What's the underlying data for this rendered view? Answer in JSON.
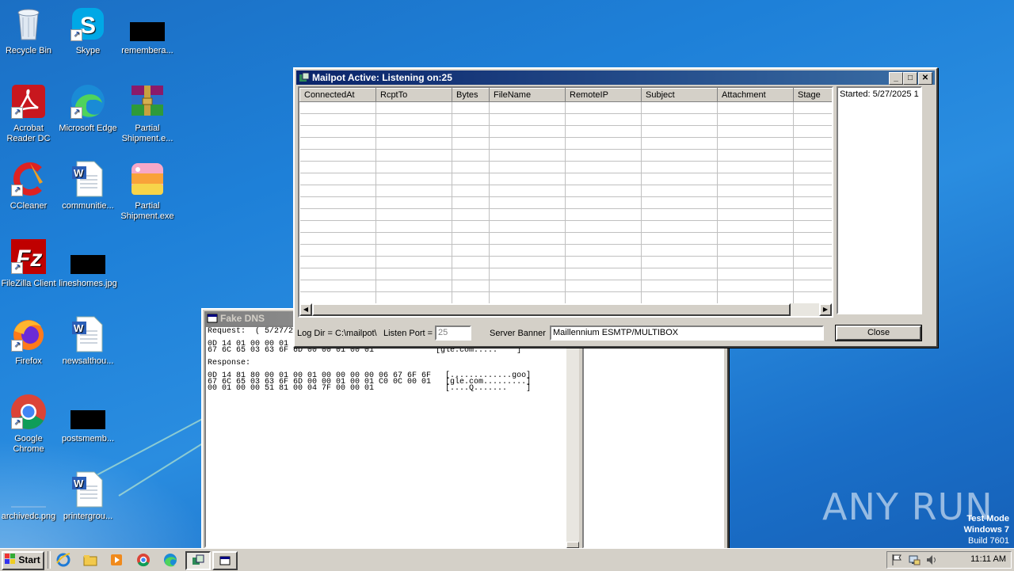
{
  "desktop": {
    "icons": [
      {
        "label": "Recycle Bin",
        "icon": "recycle-bin-icon"
      },
      {
        "label": "Skype",
        "icon": "skype-icon"
      },
      {
        "label": "remembera...",
        "icon": "black-image-icon"
      },
      {
        "label": "Acrobat\nReader DC",
        "icon": "acrobat-icon"
      },
      {
        "label": "Microsoft Edge",
        "icon": "edge-icon"
      },
      {
        "label": "Partial\nShipment.e...",
        "icon": "winrar-icon"
      },
      {
        "label": "CCleaner",
        "icon": "ccleaner-icon"
      },
      {
        "label": "communitie...",
        "icon": "word-doc-icon"
      },
      {
        "label": "Partial\nShipment.exe",
        "icon": "app-icon"
      },
      {
        "label": "FileZilla Client",
        "icon": "filezilla-icon"
      },
      {
        "label": "lineshomes.jpg",
        "icon": "black-image-icon"
      },
      {
        "label": "Firefox",
        "icon": "firefox-icon"
      },
      {
        "label": "newsalthou...",
        "icon": "word-doc-icon"
      },
      {
        "label": "Google\nChrome",
        "icon": "chrome-icon"
      },
      {
        "label": "postsmemb...",
        "icon": "black-image-icon"
      },
      {
        "label": "archivedc.png",
        "icon": "image-icon"
      },
      {
        "label": "printergrou...",
        "icon": "word-doc-icon"
      }
    ]
  },
  "mailpot": {
    "title": "Mailpot Active: Listening on:25",
    "columns": [
      "ConnectedAt",
      "RcptTo",
      "Bytes",
      "FileName",
      "RemoteIP",
      "Subject",
      "Attachment",
      "Stage"
    ],
    "log_text": "Started: 5/27/2025 1",
    "log_dir_label": "Log Dir = C:\\mailpot\\",
    "listen_port_label": "Listen Port =",
    "listen_port_value": "25",
    "server_banner_label": "Server Banner",
    "server_banner_value": "Maillennium ESMTP/MULTIBOX",
    "close_label": "Close"
  },
  "fakedns": {
    "title": "Fake DNS",
    "request_label": "Request:  ( 5/27/2",
    "request_hex": "0D 14 01 00 00 01 0\n67 6C 65 03 63 6F 6D 00 00 01 00 01             [gle.com.....    ]",
    "response_label": "Response:",
    "response_hex": "0D 14 81 80 00 01 00 01 00 00 00 00 06 67 6F 6F   [.............goo]\n67 6C 65 03 63 6F 6D 00 00 01 00 01 C0 0C 00 01   [gle.com.........]\n00 01 00 00 51 81 00 04 7F 00 00 01               [....Q.......    ]"
  },
  "watermark": {
    "brand": "ANY RUN",
    "test_mode": "Test Mode",
    "os": "Windows 7",
    "build": "Build 7601"
  },
  "taskbar": {
    "start_label": "Start",
    "clock": "11:11 AM"
  },
  "colors": {
    "title_active": "#0a246a",
    "title_inactive": "#808080",
    "desktop": "#1e80d8"
  }
}
